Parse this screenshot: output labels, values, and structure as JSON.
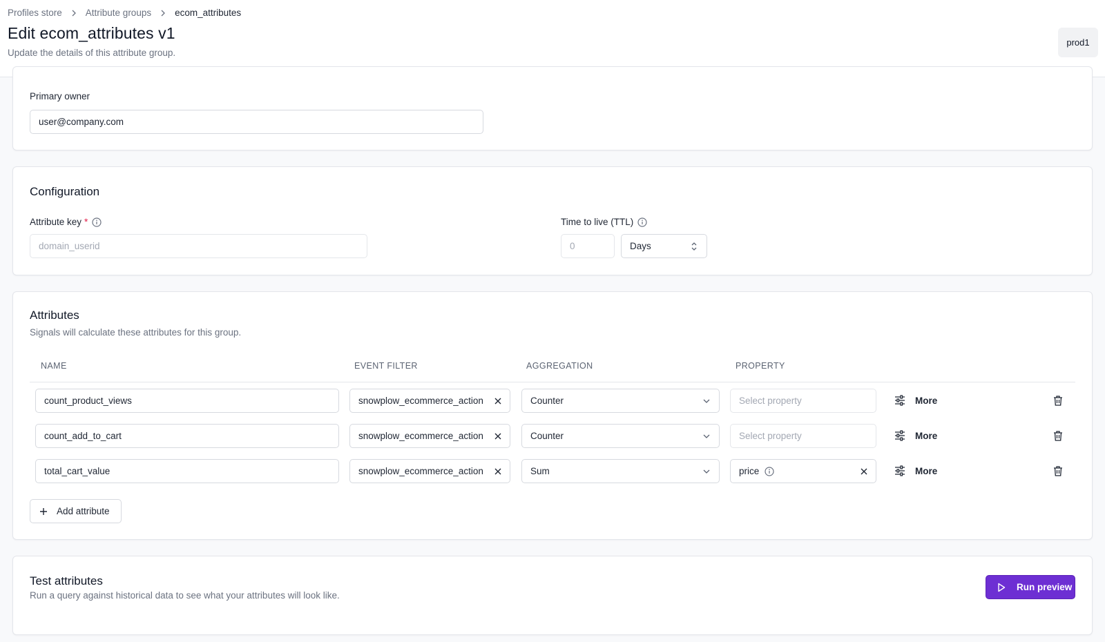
{
  "breadcrumb": {
    "items": [
      "Profiles store",
      "Attribute groups"
    ],
    "current": "ecom_attributes"
  },
  "header": {
    "title": "Edit ecom_attributes v1",
    "subtitle": "Update the details of this attribute group.",
    "environment": "prod1"
  },
  "owner": {
    "label": "Primary owner",
    "value": "user@company.com"
  },
  "configuration": {
    "title": "Configuration",
    "attribute_key_label": "Attribute key",
    "attribute_key_required": "*",
    "attribute_key_placeholder": "domain_userid",
    "ttl_label": "Time to live (TTL)",
    "ttl_value": "0",
    "ttl_unit": "Days"
  },
  "attributes": {
    "title": "Attributes",
    "description": "Signals will calculate these attributes for this group.",
    "columns": [
      "NAME",
      "EVENT FILTER",
      "AGGREGATION",
      "PROPERTY"
    ],
    "rows": [
      {
        "name": "count_product_views",
        "event_filter": "snowplow_ecommerce_action",
        "aggregation": "Counter",
        "property": "Select property",
        "property_set": false,
        "more": "More"
      },
      {
        "name": "count_add_to_cart",
        "event_filter": "snowplow_ecommerce_action",
        "aggregation": "Counter",
        "property": "Select property",
        "property_set": false,
        "more": "More"
      },
      {
        "name": "total_cart_value",
        "event_filter": "snowplow_ecommerce_action",
        "aggregation": "Sum",
        "property": "price",
        "property_set": true,
        "more": "More"
      }
    ],
    "add_label": "Add attribute"
  },
  "test": {
    "title": "Test attributes",
    "description": "Run a query against historical data to see what your attributes will look like.",
    "run_label": "Run preview"
  },
  "colors": {
    "primary": "#6d2fd3",
    "required": "#e11d48",
    "muted_text": "#6b7280"
  }
}
